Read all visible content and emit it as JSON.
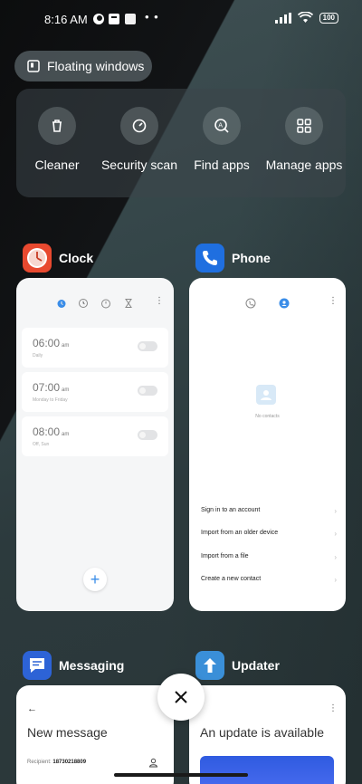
{
  "status_bar": {
    "time": "8:16 AM",
    "dots": "• •",
    "battery": "100"
  },
  "floating_windows": {
    "label": "Floating windows"
  },
  "quick_tools": [
    {
      "label": "Cleaner",
      "icon": "trash-icon"
    },
    {
      "label": "Security scan",
      "icon": "security-gauge-icon"
    },
    {
      "label": "Find apps",
      "icon": "find-apps-icon"
    },
    {
      "label": "Manage apps",
      "icon": "grid-icon"
    }
  ],
  "apps": {
    "clock": {
      "name": "Clock",
      "alarms": [
        {
          "time": "06:00",
          "period": "am",
          "sub": "Daily"
        },
        {
          "time": "07:00",
          "period": "am",
          "sub": "Monday to Friday"
        },
        {
          "time": "08:00",
          "period": "am",
          "sub": "Off, Sun"
        }
      ],
      "fab": "+"
    },
    "phone": {
      "name": "Phone",
      "no_contacts": "No contacts",
      "links": [
        "Sign in to an account",
        "Import from an older device",
        "Import from a file",
        "Create a new contact"
      ]
    },
    "messaging": {
      "name": "Messaging",
      "back": "←",
      "title": "New message",
      "recipient_label": "Recipient:",
      "recipient_value": "18730218809"
    },
    "updater": {
      "name": "Updater",
      "title": "An update is available",
      "menu": "⋮"
    }
  },
  "colors": {
    "clock_icon": "#e8492f",
    "phone_icon": "#1f6fe0",
    "messaging_icon": "#2d63d6",
    "updater_icon": "#3a8fd8",
    "accent_blue": "#3a8de8"
  }
}
